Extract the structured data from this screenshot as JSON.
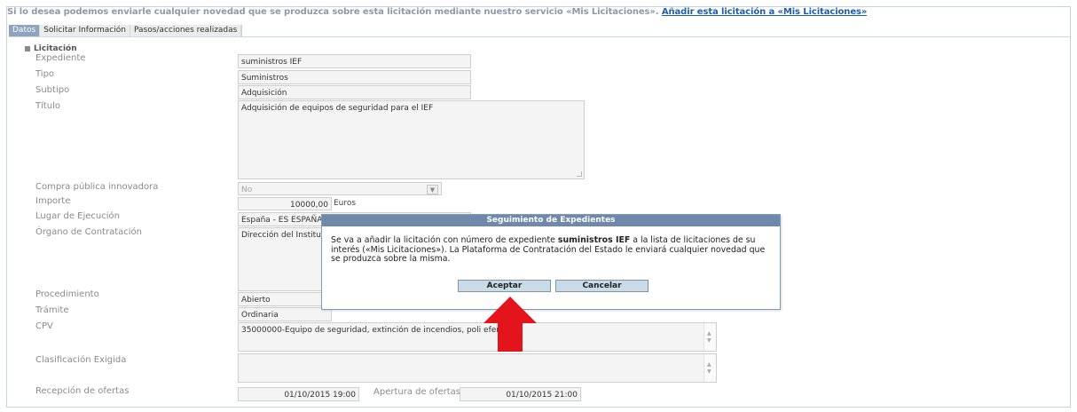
{
  "notice": {
    "text": "Si lo desea podemos enviarle cualquier novedad que se produzca sobre esta licitación mediante nuestro servicio «Mis Licitaciones».",
    "link": "Añadir esta licitación a «Mis Licitaciones»"
  },
  "tabs": [
    {
      "label": "Datos",
      "active": true
    },
    {
      "label": "Solicitar Información",
      "active": false
    },
    {
      "label": "Pasos/acciones realizadas",
      "active": false
    }
  ],
  "section": "Licitación",
  "fields": {
    "expediente": {
      "label": "Expediente",
      "value": "suministros IEF"
    },
    "tipo": {
      "label": "Tipo",
      "value": "Suministros"
    },
    "subtipo": {
      "label": "Subtipo",
      "value": "Adquisición"
    },
    "titulo": {
      "label": "Título",
      "value": "Adquisición de equipos de seguridad para el IEF"
    },
    "compra": {
      "label": "Compra pública innovadora",
      "value": "No"
    },
    "importe": {
      "label": "Importe",
      "value": "10000,00",
      "unit": "Euros"
    },
    "lugar": {
      "label": "Lugar de Ejecución",
      "value": "España - ES ESPAÑA"
    },
    "organo": {
      "label": "Órgano de Contratación",
      "value": "Dirección del Institu"
    },
    "procedimiento": {
      "label": "Procedimiento",
      "value": "Abierto"
    },
    "tramite": {
      "label": "Trámite",
      "value": "Ordinaria"
    },
    "cpv": {
      "label": "CPV",
      "value": "35000000-Equipo de seguridad, extinción de incendios, poli     efensa."
    },
    "clasificacion": {
      "label": "Clasificación Exigida",
      "value": ""
    },
    "recepcion": {
      "label": "Recepción de ofertas",
      "value": "01/10/2015 19:00"
    },
    "apertura": {
      "label": "Apertura de ofertas",
      "value": "01/10/2015 21:00"
    }
  },
  "dialog": {
    "title": "Seguimiento de Expedientes",
    "msg_pre": "Se va a añadir la licitación con número de expediente ",
    "msg_bold": "suministros IEF",
    "msg_post": " a la lista de licitaciones de su interés («Mis Licitaciones»). La Plataforma de Contratación del Estado le enviará cualquier novedad que se produzca sobre la misma.",
    "accept": "Aceptar",
    "cancel": "Cancelar"
  },
  "colors": {
    "arrow": "#e3141b",
    "dialog_title": "#6f89ab",
    "link": "#1f5ea8"
  }
}
